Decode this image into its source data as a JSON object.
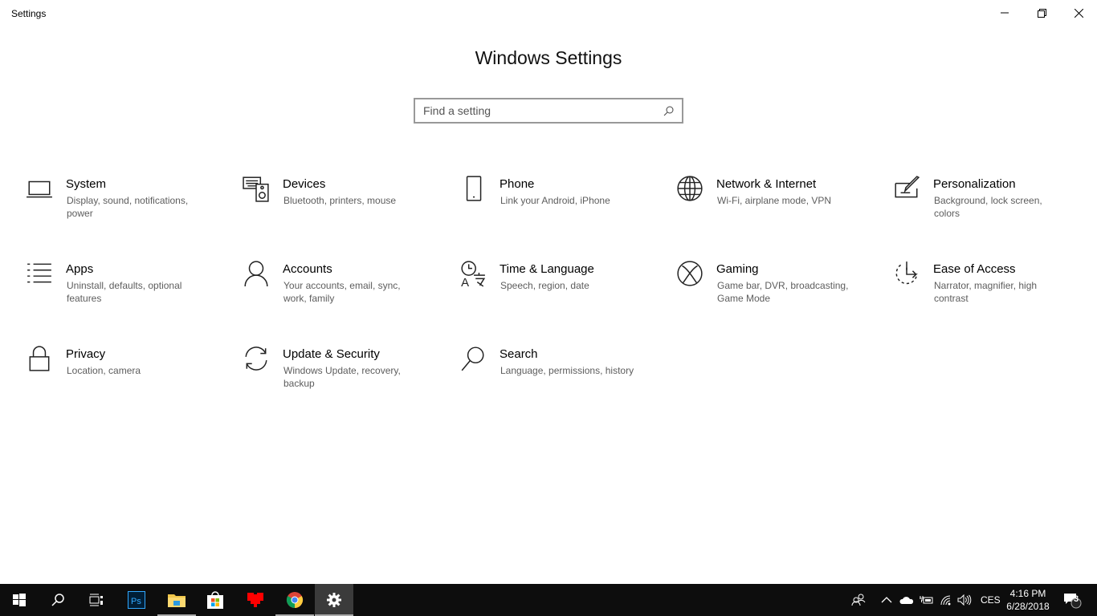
{
  "window": {
    "title": "Settings"
  },
  "heading": "Windows Settings",
  "search": {
    "placeholder": "Find a setting"
  },
  "tiles": [
    {
      "title": "System",
      "desc": "Display, sound, notifications, power",
      "icon": "laptop-icon"
    },
    {
      "title": "Devices",
      "desc": "Bluetooth, printers, mouse",
      "icon": "devices-icon"
    },
    {
      "title": "Phone",
      "desc": "Link your Android, iPhone",
      "icon": "phone-icon"
    },
    {
      "title": "Network & Internet",
      "desc": "Wi-Fi, airplane mode, VPN",
      "icon": "globe-icon"
    },
    {
      "title": "Personalization",
      "desc": "Background, lock screen, colors",
      "icon": "paint-icon"
    },
    {
      "title": "Apps",
      "desc": "Uninstall, defaults, optional features",
      "icon": "apps-list-icon"
    },
    {
      "title": "Accounts",
      "desc": "Your accounts, email, sync, work, family",
      "icon": "person-icon"
    },
    {
      "title": "Time & Language",
      "desc": "Speech, region, date",
      "icon": "time-language-icon"
    },
    {
      "title": "Gaming",
      "desc": "Game bar, DVR, broadcasting, Game Mode",
      "icon": "xbox-icon"
    },
    {
      "title": "Ease of Access",
      "desc": "Narrator, magnifier, high contrast",
      "icon": "ease-of-access-icon"
    },
    {
      "title": "Privacy",
      "desc": "Location, camera",
      "icon": "lock-icon"
    },
    {
      "title": "Update & Security",
      "desc": "Windows Update, recovery, backup",
      "icon": "sync-icon"
    },
    {
      "title": "Search",
      "desc": "Language, permissions, history",
      "icon": "search-icon"
    }
  ],
  "taskbar": {
    "language": "CES",
    "time": "4:16 PM",
    "date": "6/28/2018",
    "notifications": "3"
  }
}
